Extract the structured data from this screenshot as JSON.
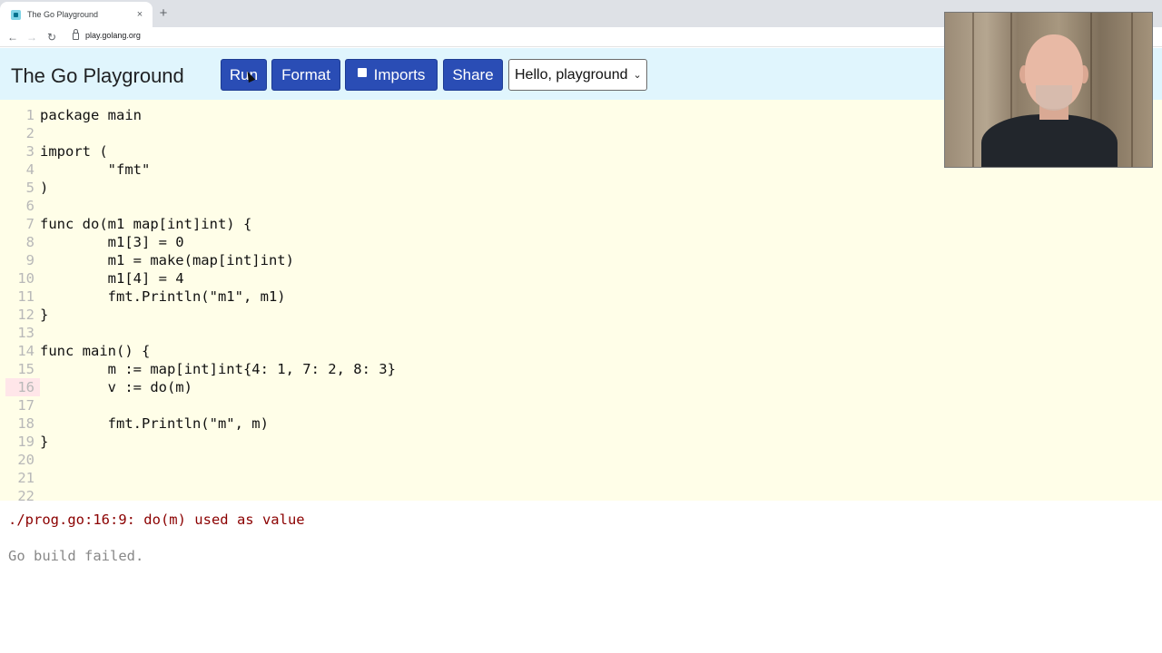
{
  "browser": {
    "tab_title": "The Go Playground",
    "tab_close": "×",
    "new_tab": "+",
    "url": "play.golang.org",
    "back_icon": "←",
    "forward_icon": "→",
    "reload_icon": "↻"
  },
  "header": {
    "title": "The Go Playground",
    "run_label": "Run",
    "format_label": "Format",
    "imports_label": "Imports",
    "share_label": "Share",
    "example_select": "Hello, playground",
    "chevron": "⌄"
  },
  "editor": {
    "lines": [
      {
        "no": "1",
        "text": "package main"
      },
      {
        "no": "2",
        "text": ""
      },
      {
        "no": "3",
        "text": "import ("
      },
      {
        "no": "4",
        "text": "        \"fmt\""
      },
      {
        "no": "5",
        "text": ")"
      },
      {
        "no": "6",
        "text": ""
      },
      {
        "no": "7",
        "text": "func do(m1 map[int]int) {"
      },
      {
        "no": "8",
        "text": "        m1[3] = 0"
      },
      {
        "no": "9",
        "text": "        m1 = make(map[int]int)"
      },
      {
        "no": "10",
        "text": "        m1[4] = 4"
      },
      {
        "no": "11",
        "text": "        fmt.Println(\"m1\", m1)"
      },
      {
        "no": "12",
        "text": "}"
      },
      {
        "no": "13",
        "text": ""
      },
      {
        "no": "14",
        "text": "func main() {"
      },
      {
        "no": "15",
        "text": "        m := map[int]int{4: 1, 7: 2, 8: 3}"
      },
      {
        "no": "16",
        "text": "        v := do(m)"
      },
      {
        "no": "17",
        "text": ""
      },
      {
        "no": "18",
        "text": "        fmt.Println(\"m\", m)"
      },
      {
        "no": "19",
        "text": "}"
      },
      {
        "no": "20",
        "text": ""
      },
      {
        "no": "21",
        "text": ""
      },
      {
        "no": "22",
        "text": ""
      }
    ],
    "error_line": "16"
  },
  "output": {
    "error_message": "./prog.go:16:9: do(m) used as value",
    "status": "Go build failed."
  }
}
